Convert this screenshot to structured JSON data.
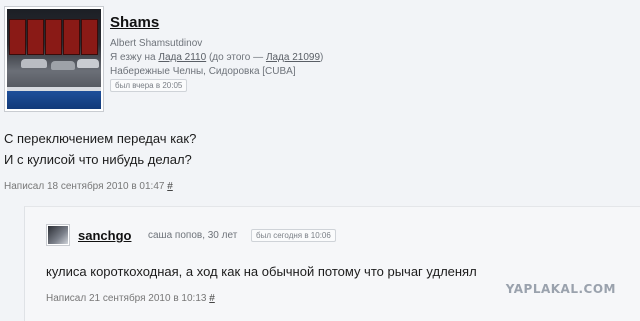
{
  "post": {
    "username": "Shams",
    "full_name": "Albert Shamsutdinov",
    "cars_prefix": "Я езжу на ",
    "car_current": "Лада 2110",
    "cars_middle": " (до этого — ",
    "car_previous": "Лада 21099",
    "cars_suffix": ")",
    "location": "Набережные Челны, Сидоровка [CUBA]",
    "last_seen": "был вчера в 20:05",
    "text_lines": [
      "С переключением передач как?",
      "И с кулисой что нибудь делал?"
    ],
    "posted_label": "Написал 18 сентября 2010 в 01:47",
    "anchor": "#"
  },
  "reply": {
    "username": "sanchgo",
    "meta": "саша попов, 30 лет",
    "last_seen": "был сегодня в 10:06",
    "text": "кулиса короткоходная, а ход как на обычной потому что рычаг удленял",
    "posted_label": "Написал 21 сентября 2010 в 10:13",
    "anchor": "#"
  },
  "watermark": "YAPLAKAL.COM"
}
